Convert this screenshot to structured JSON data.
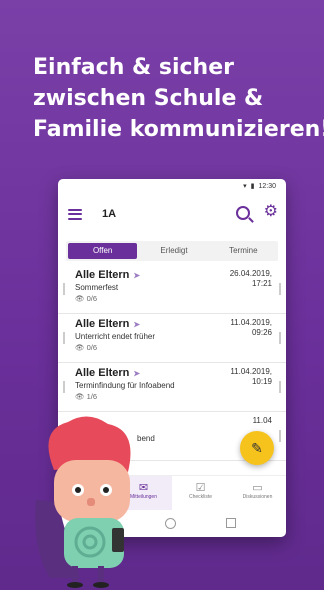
{
  "headline": [
    "Einfach & sicher",
    "zwischen Schule &",
    "Familie kommunizieren!"
  ],
  "status": {
    "time": "12:30"
  },
  "appbar": {
    "title": "1A",
    "menu_icon": "menu-icon",
    "search_icon": "search-icon",
    "settings_icon": "gear-icon"
  },
  "tabs": [
    {
      "label": "Offen",
      "active": true
    },
    {
      "label": "Erledigt",
      "active": false
    },
    {
      "label": "Termine",
      "active": false
    }
  ],
  "messages": [
    {
      "sender": "Alle Eltern",
      "subject": "Sommerfest",
      "seen": "0/6",
      "date": "26.04.2019,",
      "time": "17:21"
    },
    {
      "sender": "Alle Eltern",
      "subject": "Unterricht endet früher",
      "seen": "0/6",
      "date": "11.04.2019,",
      "time": "09:26"
    },
    {
      "sender": "Alle Eltern",
      "subject": "Terminfindung für Infoabend",
      "seen": "1/6",
      "date": "11.04.2019,",
      "time": "10:19"
    },
    {
      "sender": "",
      "subject": "bend",
      "seen": "",
      "date": "11.04",
      "time": ""
    }
  ],
  "bottom_nav": [
    {
      "label": "",
      "icon": "hidden-icon"
    },
    {
      "label": "Mitteilungen",
      "icon": "mail-icon",
      "active": true
    },
    {
      "label": "Checkliste",
      "icon": "checklist-icon"
    },
    {
      "label": "Diskussionen",
      "icon": "chat-icon"
    }
  ],
  "fab": {
    "icon": "edit-icon"
  },
  "colors": {
    "primary": "#6a2f9a",
    "accent": "#f6c21c",
    "background": "#7b3fa8"
  }
}
